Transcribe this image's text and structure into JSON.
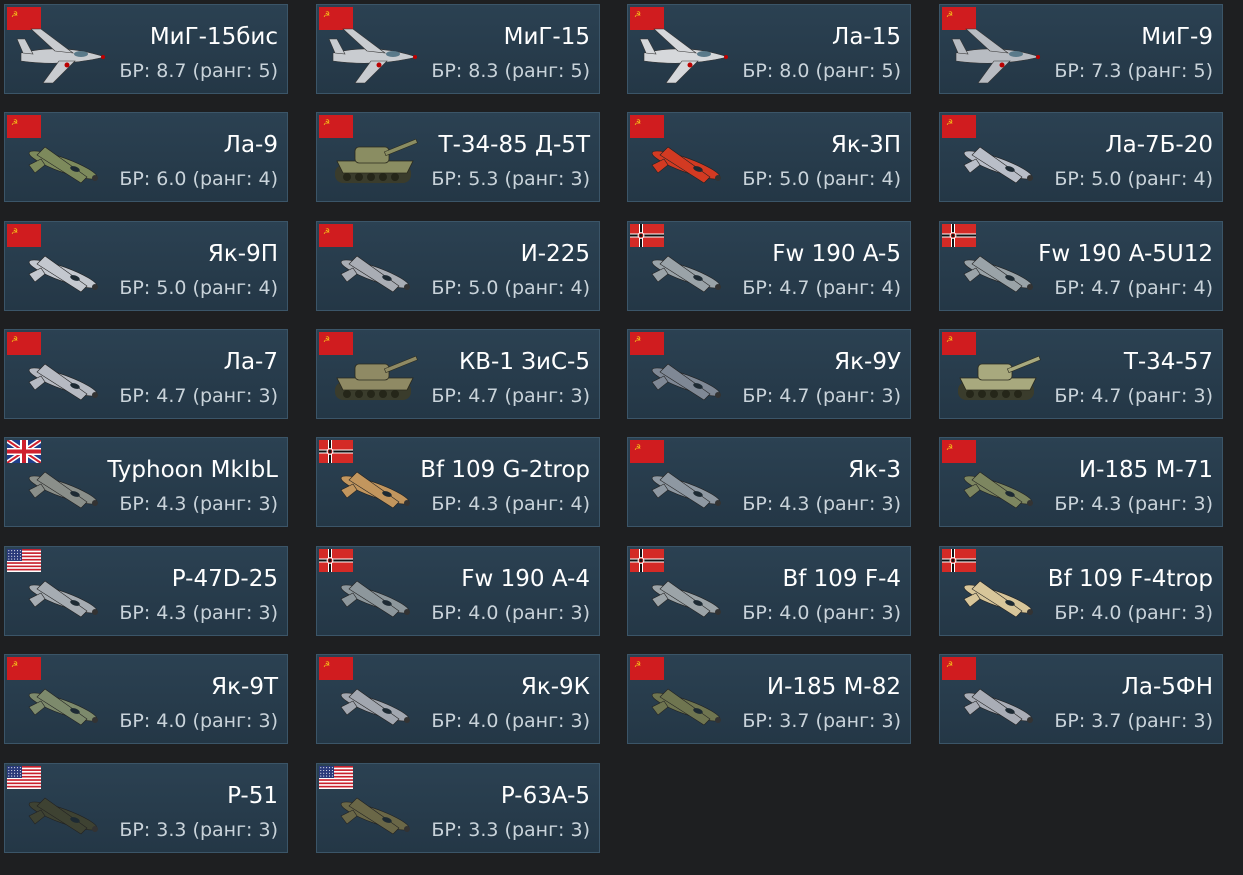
{
  "cards": [
    {
      "name": "МиГ-15бис",
      "br": "БР: 8.7 (ранг: 5)",
      "flag": "ussr",
      "kind": "jet",
      "color": "#c9ccd0"
    },
    {
      "name": "МиГ-15",
      "br": "БР: 8.3 (ранг: 5)",
      "flag": "ussr",
      "kind": "jet",
      "color": "#c9ccd0"
    },
    {
      "name": "Ла-15",
      "br": "БР: 8.0 (ранг: 5)",
      "flag": "ussr",
      "kind": "jet",
      "color": "#d6d8db"
    },
    {
      "name": "МиГ-9",
      "br": "БР: 7.3 (ранг: 5)",
      "flag": "ussr",
      "kind": "jet",
      "color": "#b8bcc2"
    },
    {
      "name": "Ла-9",
      "br": "БР: 6.0 (ранг: 4)",
      "flag": "ussr",
      "kind": "plane",
      "color": "#7d8a5c"
    },
    {
      "name": "Т-34-85 Д-5Т",
      "br": "БР: 5.3 (ранг: 3)",
      "flag": "ussr",
      "kind": "tank",
      "color": "#8a8d62"
    },
    {
      "name": "Як-3П",
      "br": "БР: 5.0 (ранг: 4)",
      "flag": "ussr",
      "kind": "plane",
      "color": "#d33a22"
    },
    {
      "name": "Ла-7Б-20",
      "br": "БР: 5.0 (ранг: 4)",
      "flag": "ussr",
      "kind": "plane",
      "color": "#b9bec8"
    },
    {
      "name": "Як-9П",
      "br": "БР: 5.0 (ранг: 4)",
      "flag": "ussr",
      "kind": "plane",
      "color": "#c4c8cf"
    },
    {
      "name": "И-225",
      "br": "БР: 5.0 (ранг: 4)",
      "flag": "ussr",
      "kind": "plane",
      "color": "#a9adb4"
    },
    {
      "name": "Fw 190 A-5",
      "br": "БР: 4.7 (ранг: 4)",
      "flag": "germany",
      "kind": "plane",
      "color": "#9aa3a8"
    },
    {
      "name": "Fw 190 A-5U12",
      "br": "БР: 4.7 (ранг: 4)",
      "flag": "germany",
      "kind": "plane",
      "color": "#9aa3a8"
    },
    {
      "name": "Ла-7",
      "br": "БР: 4.7 (ранг: 3)",
      "flag": "ussr",
      "kind": "plane",
      "color": "#b6bac2"
    },
    {
      "name": "КВ-1 ЗиС-5",
      "br": "БР: 4.7 (ранг: 3)",
      "flag": "ussr",
      "kind": "tank",
      "color": "#8f8a64"
    },
    {
      "name": "Як-9У",
      "br": "БР: 4.7 (ранг: 3)",
      "flag": "ussr",
      "kind": "plane",
      "color": "#7f8895"
    },
    {
      "name": "Т-34-57",
      "br": "БР: 4.7 (ранг: 3)",
      "flag": "ussr",
      "kind": "tank",
      "color": "#a8a97e"
    },
    {
      "name": "Typhoon MkIbL",
      "br": "БР: 4.3 (ранг: 3)",
      "flag": "uk",
      "kind": "plane",
      "color": "#8a8f8a"
    },
    {
      "name": "Bf 109 G-2trop",
      "br": "БР: 4.3 (ранг: 4)",
      "flag": "germany",
      "kind": "plane",
      "color": "#c2965e"
    },
    {
      "name": "Як-3",
      "br": "БР: 4.3 (ранг: 3)",
      "flag": "ussr",
      "kind": "plane",
      "color": "#8e98a2"
    },
    {
      "name": "И-185 М-71",
      "br": "БР: 4.3 (ранг: 3)",
      "flag": "ussr",
      "kind": "plane",
      "color": "#7d8660"
    },
    {
      "name": "P-47D-25",
      "br": "БР: 4.3 (ранг: 3)",
      "flag": "usa",
      "kind": "plane",
      "color": "#a6acb2"
    },
    {
      "name": "Fw 190 A-4",
      "br": "БР: 4.0 (ранг: 3)",
      "flag": "germany",
      "kind": "plane",
      "color": "#8d979c"
    },
    {
      "name": "Bf 109 F-4",
      "br": "БР: 4.0 (ранг: 3)",
      "flag": "germany",
      "kind": "plane",
      "color": "#9ca4a8"
    },
    {
      "name": "Bf 109 F-4trop",
      "br": "БР: 4.0 (ранг: 3)",
      "flag": "germany",
      "kind": "plane",
      "color": "#d8c69a"
    },
    {
      "name": "Як-9Т",
      "br": "БР: 4.0 (ранг: 3)",
      "flag": "ussr",
      "kind": "plane",
      "color": "#7d8a6c"
    },
    {
      "name": "Як-9К",
      "br": "БР: 4.0 (ранг: 3)",
      "flag": "ussr",
      "kind": "plane",
      "color": "#a2a7b0"
    },
    {
      "name": "И-185 М-82",
      "br": "БР: 3.7 (ранг: 3)",
      "flag": "ussr",
      "kind": "plane",
      "color": "#6f7550"
    },
    {
      "name": "Ла-5ФН",
      "br": "БР: 3.7 (ранг: 3)",
      "flag": "ussr",
      "kind": "plane",
      "color": "#a9adb6"
    },
    {
      "name": "P-51",
      "br": "БР: 3.3 (ранг: 3)",
      "flag": "usa",
      "kind": "plane",
      "color": "#3e4232"
    },
    {
      "name": "P-63A-5",
      "br": "БР: 3.3 (ранг: 3)",
      "flag": "usa",
      "kind": "plane",
      "color": "#6a6747"
    }
  ]
}
